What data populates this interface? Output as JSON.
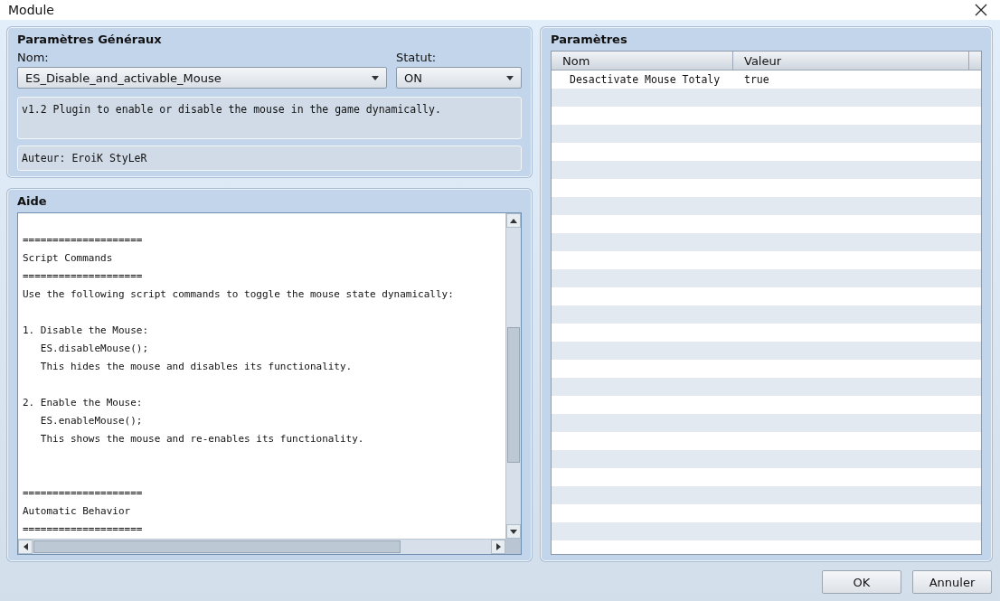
{
  "window": {
    "title": "Module"
  },
  "general": {
    "title": "Paramètres Généraux",
    "name_label": "Nom:",
    "name_value": "ES_Disable_and_activable_Mouse",
    "status_label": "Statut:",
    "status_value": "ON",
    "description": "v1.2 Plugin to enable or disable the mouse in the game dynamically.",
    "author": "Auteur: EroiK StyLeR"
  },
  "help": {
    "title": "Aide",
    "text": "\n====================\nScript Commands\n====================\nUse the following script commands to toggle the mouse state dynamically:\n\n1. Disable the Mouse:\n   ES.disableMouse();\n   This hides the mouse and disables its functionality.\n\n2. Enable the Mouse:\n   ES.enableMouse();\n   This shows the mouse and re-enables its functionality.\n\n\n====================\nAutomatic Behavior\n===================="
  },
  "parameters": {
    "title": "Paramètres",
    "columns": [
      "Nom",
      "Valeur"
    ],
    "rows": [
      {
        "name": "Desactivate Mouse Totaly",
        "value": "true"
      }
    ]
  },
  "buttons": [
    "OK",
    "Annuler"
  ]
}
